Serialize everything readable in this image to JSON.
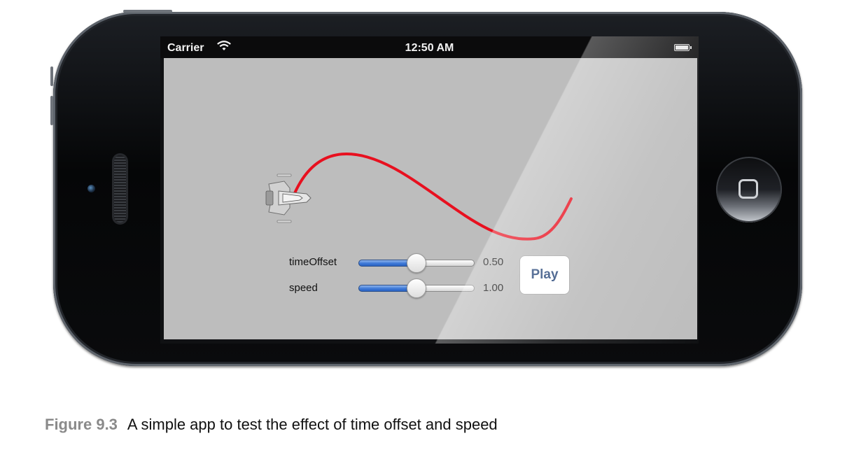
{
  "status_bar": {
    "carrier": "Carrier",
    "time": "12:50 AM",
    "wifi_icon": "wifi-icon",
    "battery_icon": "battery-icon"
  },
  "app": {
    "curve_color": "#e8101f",
    "ship_icon": "spaceship-icon",
    "sliders": [
      {
        "label": "timeOffset",
        "value_text": "0.50",
        "fraction": 0.5
      },
      {
        "label": "speed",
        "value_text": "1.00",
        "fraction": 0.5
      }
    ],
    "play_label": "Play",
    "accent_color": "#3d79d8"
  },
  "caption": {
    "figure_label": "Figure 9.3",
    "text": "A simple app to test the effect of time offset and speed"
  }
}
